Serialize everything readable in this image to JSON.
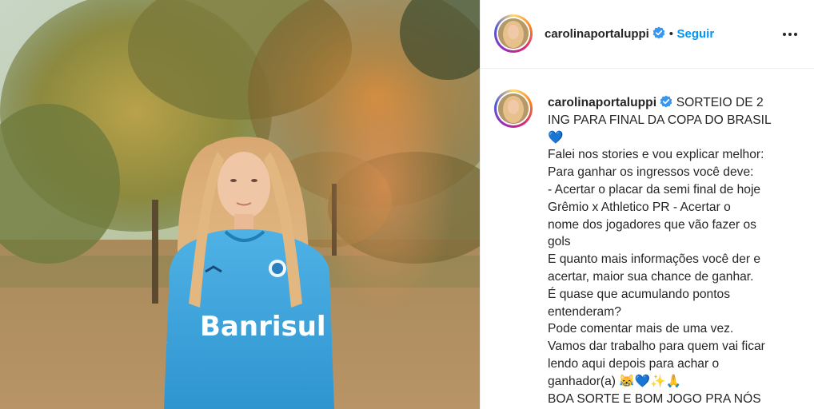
{
  "post": {
    "username": "carolinaportaluppi",
    "follow_label": "Seguir",
    "separator": "•",
    "verified_icon": "verified-badge-icon",
    "more_icon": "more-options-icon"
  },
  "photo": {
    "jersey_text": "Banrisul"
  },
  "caption": {
    "username": "carolinaportaluppi",
    "lines": [
      "SORTEIO DE 2",
      "ING PARA FINAL DA COPA DO BRASIL",
      "💙",
      "Falei nos stories e vou explicar melhor:",
      "Para ganhar os ingressos você deve:",
      "- Acertar o placar da semi final de hoje",
      "Grêmio x Athletico PR - Acertar o",
      "nome dos jogadores que vão fazer os",
      "gols",
      "E quanto mais informações você der e",
      "acertar, maior sua chance de ganhar.",
      "É quase que acumulando pontos",
      "entenderam?",
      "Pode comentar mais de uma vez.",
      "Vamos dar trabalho para quem vai ficar",
      "lendo aqui depois para achar o",
      "ganhador(a) 😹💙✨🙏",
      "BOA SORTE E BOM JOGO PRA NÓS"
    ]
  },
  "colors": {
    "link_blue": "#0095f6",
    "verified_blue": "#3897f0",
    "jersey_blue": "#3aa6dd"
  }
}
